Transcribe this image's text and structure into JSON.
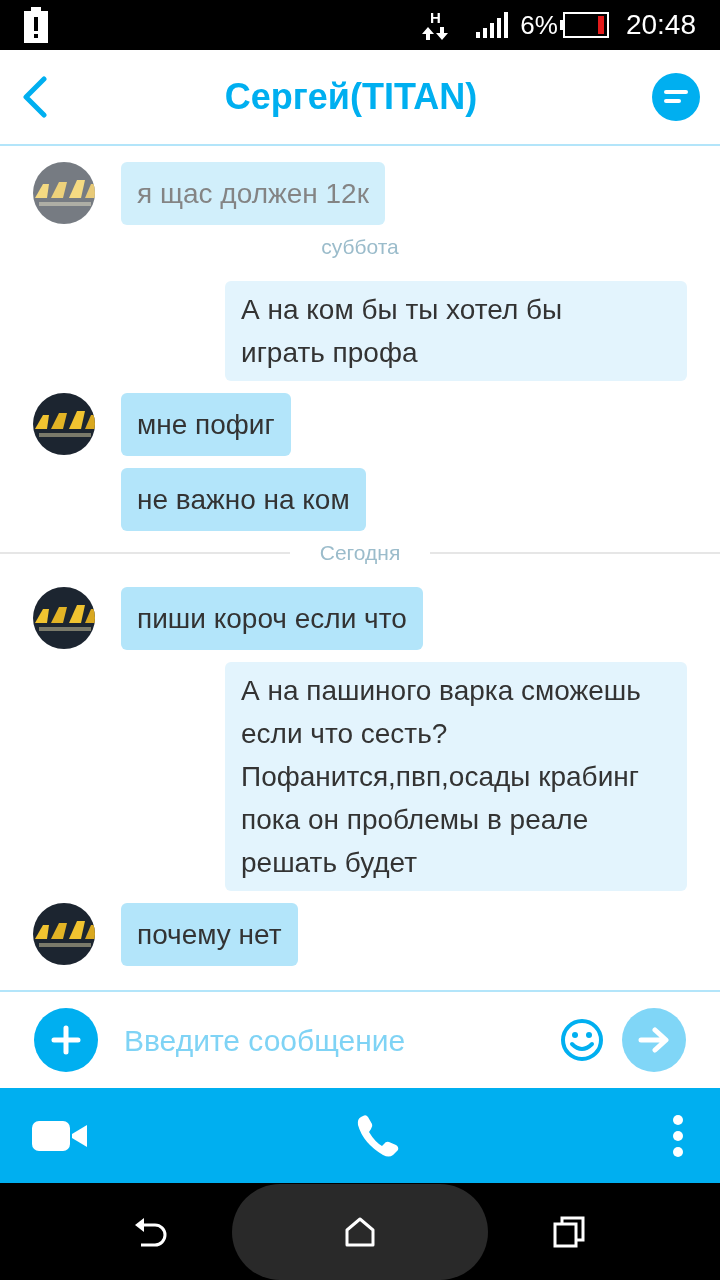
{
  "status_bar": {
    "network": "H",
    "battery_percent": "6%",
    "time": "20:48"
  },
  "header": {
    "title": "Сергей(TITAN)"
  },
  "messages": [
    {
      "kind": "incoming",
      "text": "я щас должен 12к",
      "avatar": true,
      "faded": true
    },
    {
      "kind": "date",
      "text": "суббота",
      "divider": false
    },
    {
      "kind": "outgoing",
      "text": "А на ком бы ты хотел бы играть профа"
    },
    {
      "kind": "incoming",
      "text": "мне пофиг",
      "avatar": true,
      "faded": false
    },
    {
      "kind": "incoming",
      "text": "не важно на ком",
      "avatar": false,
      "faded": false
    },
    {
      "kind": "date",
      "text": "Сегодня",
      "divider": true
    },
    {
      "kind": "incoming",
      "text": "пиши короч если что",
      "avatar": true,
      "faded": false
    },
    {
      "kind": "outgoing",
      "text": "А на пашиного варка сможешь если что сесть? Пофанится,пвп,осады крабинг пока он проблемы в реале решать будет"
    },
    {
      "kind": "incoming",
      "text": "почему нет",
      "avatar": true,
      "faded": false
    }
  ],
  "composer": {
    "placeholder": "Введите сообщение"
  }
}
